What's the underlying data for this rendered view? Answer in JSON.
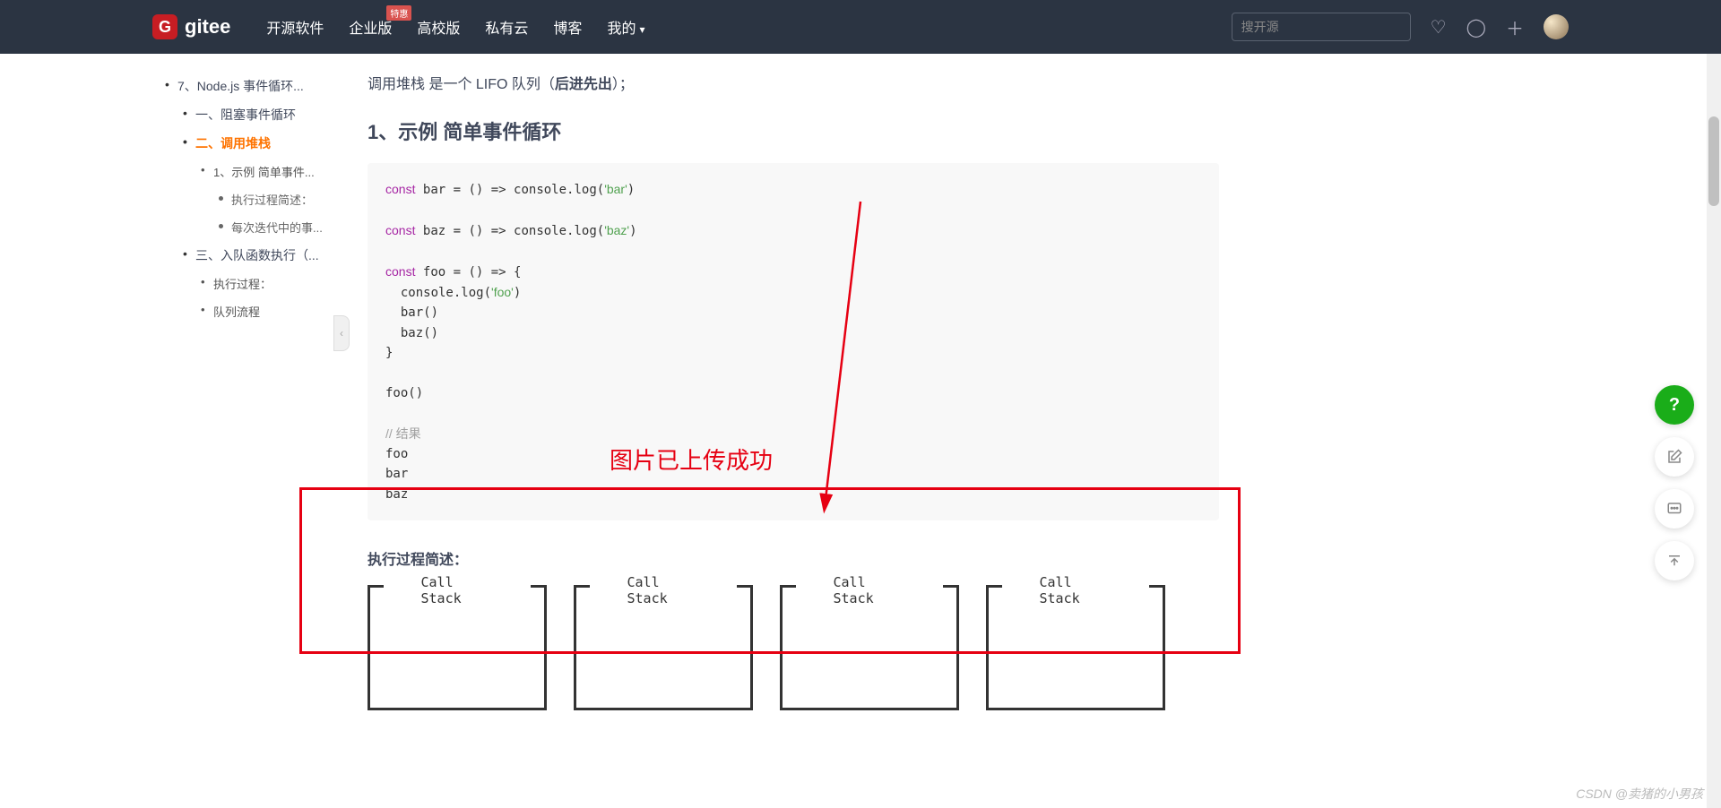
{
  "header": {
    "logo_letter": "G",
    "logo_text": "gitee",
    "nav": [
      "开源软件",
      "企业版",
      "高校版",
      "私有云",
      "博客",
      "我的"
    ],
    "nav_badge": "特惠",
    "search_placeholder": "搜开源"
  },
  "sidebar": {
    "items": [
      {
        "level": 1,
        "label": "7、Node.js 事件循环...",
        "active": false
      },
      {
        "level": 2,
        "label": "一、阻塞事件循环",
        "active": false
      },
      {
        "level": 2,
        "label": "二、调用堆栈",
        "active": true
      },
      {
        "level": 3,
        "label": "1、示例 简单事件...",
        "active": false
      },
      {
        "level": 4,
        "label": "执行过程简述：",
        "active": false
      },
      {
        "level": 4,
        "label": "每次迭代中的事...",
        "active": false
      },
      {
        "level": 2,
        "label": "三、入队函数执行（...",
        "active": false
      },
      {
        "level": 3,
        "label": "执行过程：",
        "active": false
      },
      {
        "level": 3,
        "label": "队列流程",
        "active": false
      }
    ]
  },
  "content": {
    "intro_prefix": "调用堆栈 是一个 LIFO 队列（",
    "intro_bold": "后进先出",
    "intro_suffix": "）；",
    "h2": "1、示例 简单事件循环",
    "h3": "执行过程简述：",
    "code_plain": "const bar = () => console.log('bar')\n\nconst baz = () => console.log('baz')\n\nconst foo = () => {\n  console.log('foo')\n  bar()\n  baz()\n}\n\nfoo()\n\n// 结果\nfoo\nbar\nbaz",
    "stacks": [
      "Call Stack",
      "Call Stack",
      "Call Stack",
      "Call Stack"
    ]
  },
  "annotation": {
    "text": "图片已上传成功"
  },
  "float": {
    "help": "?"
  },
  "watermark": "CSDN @卖猪的小男孩"
}
